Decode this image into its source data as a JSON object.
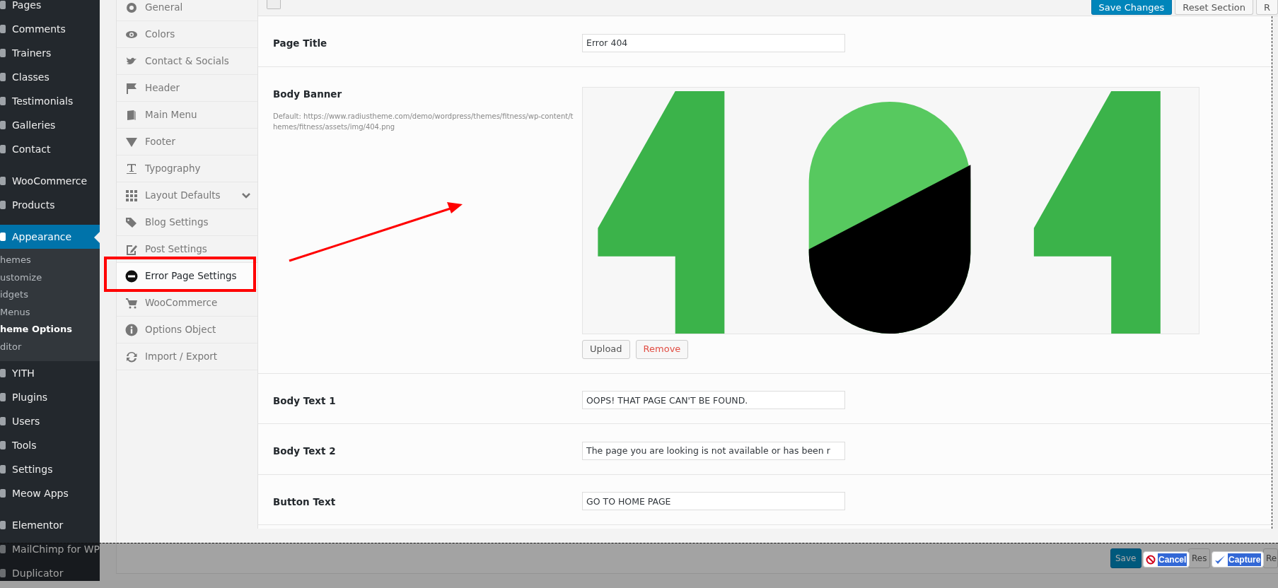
{
  "admin_menu": [
    {
      "items": [
        {
          "label": "Pages",
          "selected": false
        },
        {
          "label": "Comments",
          "selected": false
        },
        {
          "label": "Trainers",
          "selected": false
        },
        {
          "label": "Classes",
          "selected": false
        },
        {
          "label": "Testimonials",
          "selected": false
        },
        {
          "label": "Galleries",
          "selected": false
        },
        {
          "label": "Contact",
          "selected": false
        }
      ]
    },
    {
      "items": [
        {
          "label": "WooCommerce",
          "selected": false
        },
        {
          "label": "Products",
          "selected": false
        }
      ]
    },
    {
      "items": [
        {
          "label": "Appearance",
          "selected": true,
          "children": [
            {
              "label": "hemes",
              "selected": false
            },
            {
              "label": "ustomize",
              "selected": false
            },
            {
              "label": "idgets",
              "selected": false
            },
            {
              "label": "Menus",
              "selected": false
            },
            {
              "label": "heme Options",
              "selected": true
            },
            {
              "label": "ditor",
              "selected": false
            }
          ]
        },
        {
          "label": "YITH",
          "selected": false
        },
        {
          "label": "Plugins",
          "selected": false
        },
        {
          "label": "Users",
          "selected": false
        },
        {
          "label": "Tools",
          "selected": false
        },
        {
          "label": "Settings",
          "selected": false
        },
        {
          "label": "Meow Apps",
          "selected": false
        }
      ]
    },
    {
      "items": [
        {
          "label": "Elementor",
          "selected": false
        },
        {
          "label": "MailChimp for WP",
          "selected": false
        },
        {
          "label": "Duplicator",
          "selected": false
        }
      ]
    }
  ],
  "options_menu": [
    {
      "label": "General",
      "selected": false,
      "expandable": false
    },
    {
      "label": "Colors",
      "selected": false,
      "expandable": false
    },
    {
      "label": "Contact & Socials",
      "selected": false,
      "expandable": false
    },
    {
      "label": "Header",
      "selected": false,
      "expandable": false
    },
    {
      "label": "Main Menu",
      "selected": false,
      "expandable": false
    },
    {
      "label": "Footer",
      "selected": false,
      "expandable": false
    },
    {
      "label": "Typography",
      "selected": false,
      "expandable": false
    },
    {
      "label": "Layout Defaults",
      "selected": false,
      "expandable": true
    },
    {
      "label": "Blog Settings",
      "selected": false,
      "expandable": false
    },
    {
      "label": "Post Settings",
      "selected": false,
      "expandable": false
    },
    {
      "label": "Error Page Settings",
      "selected": true,
      "expandable": false
    },
    {
      "label": "WooCommerce",
      "selected": false,
      "expandable": false
    },
    {
      "label": "Options Object",
      "selected": false,
      "expandable": false
    },
    {
      "label": "Import / Export",
      "selected": false,
      "expandable": false
    }
  ],
  "toolbar": {
    "buttons": [
      {
        "label": "Save Changes",
        "kind": "primary"
      },
      {
        "label": "Reset Section",
        "kind": "default"
      },
      {
        "label": "R",
        "kind": "default"
      }
    ]
  },
  "fields": [
    {
      "label": "Page Title",
      "kind": "text",
      "value": "Error 404"
    },
    {
      "label": "Body Banner",
      "kind": "media",
      "description": "Default: https://www.radiustheme.com/demo/wordpress/themes/fitness/wp-content/themes/fitness/assets/img/404.png",
      "buttons": [
        {
          "label": "Upload",
          "kind": "default"
        },
        {
          "label": "Remove",
          "kind": "danger"
        }
      ]
    },
    {
      "label": "Body Text 1",
      "kind": "text",
      "value": "OOPS! THAT PAGE CAN'T BE FOUND."
    },
    {
      "label": "Body Text 2",
      "kind": "text",
      "value": "The page you are looking is not available or has been r"
    },
    {
      "label": "Button Text",
      "kind": "text",
      "value": "GO TO HOME PAGE"
    }
  ],
  "footer": {
    "buttons": [
      {
        "label": "Save",
        "kind": "primary"
      },
      {
        "label": "Res",
        "kind": "default"
      },
      {
        "label": "Re",
        "kind": "default"
      }
    ]
  },
  "capture_bar": {
    "buttons": [
      {
        "label": "Cancel",
        "kind": "cancel"
      },
      {
        "label": "Capture",
        "kind": "confirm"
      }
    ]
  }
}
